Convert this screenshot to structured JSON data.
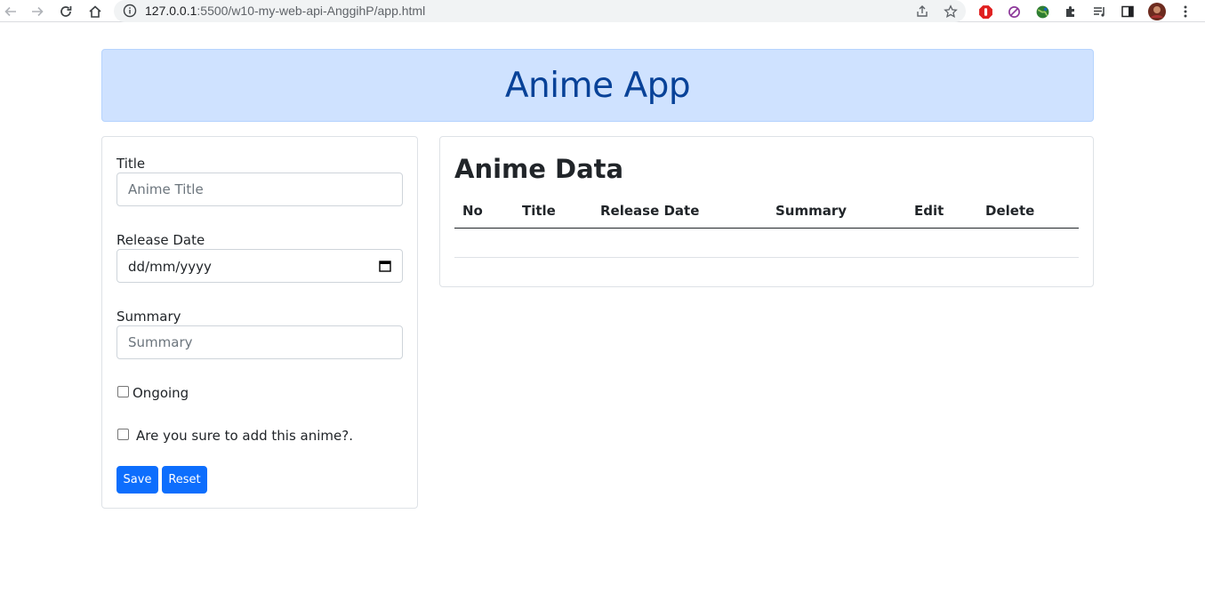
{
  "browser": {
    "url_host": "127.0.0.1",
    "url_path": ":5500/w10-my-web-api-AnggihP/app.html"
  },
  "header": {
    "title": "Anime App"
  },
  "form": {
    "title_label": "Title",
    "title_placeholder": "Anime Title",
    "release_label": "Release Date",
    "release_value": "dd/mm/yyyy",
    "summary_label": "Summary",
    "summary_placeholder": "Summary",
    "ongoing_label": "Ongoing",
    "confirm_label": "Are you sure to add this anime?.",
    "save_label": "Save",
    "reset_label": "Reset"
  },
  "table": {
    "title": "Anime Data",
    "columns": [
      "No",
      "Title",
      "Release Date",
      "Summary",
      "Edit",
      "Delete"
    ],
    "rows": []
  }
}
